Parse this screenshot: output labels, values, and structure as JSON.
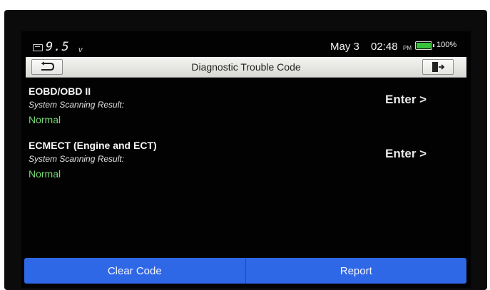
{
  "status": {
    "voltage": "9.5",
    "voltage_unit": "v",
    "date": "May 3",
    "time": "02:48",
    "ampm": "PM",
    "battery_percent": "100%",
    "battery_level": 1.0,
    "battery_color": "#38c13a"
  },
  "header": {
    "title": "Diagnostic Trouble Code",
    "back_icon": "back-arrow-icon",
    "exit_icon": "exit-door-icon"
  },
  "systems": [
    {
      "name": "EOBD/OBD II",
      "subtitle": "System Scanning Result:",
      "status": "Normal",
      "action": "Enter >"
    },
    {
      "name": "ECMECT (Engine and ECT)",
      "subtitle": "System Scanning Result:",
      "status": "Normal",
      "action": "Enter >"
    }
  ],
  "actions": {
    "clear_code": "Clear Code",
    "report": "Report"
  },
  "colors": {
    "accent": "#2f68e6",
    "status_normal": "#74d874",
    "background": "#020202"
  }
}
